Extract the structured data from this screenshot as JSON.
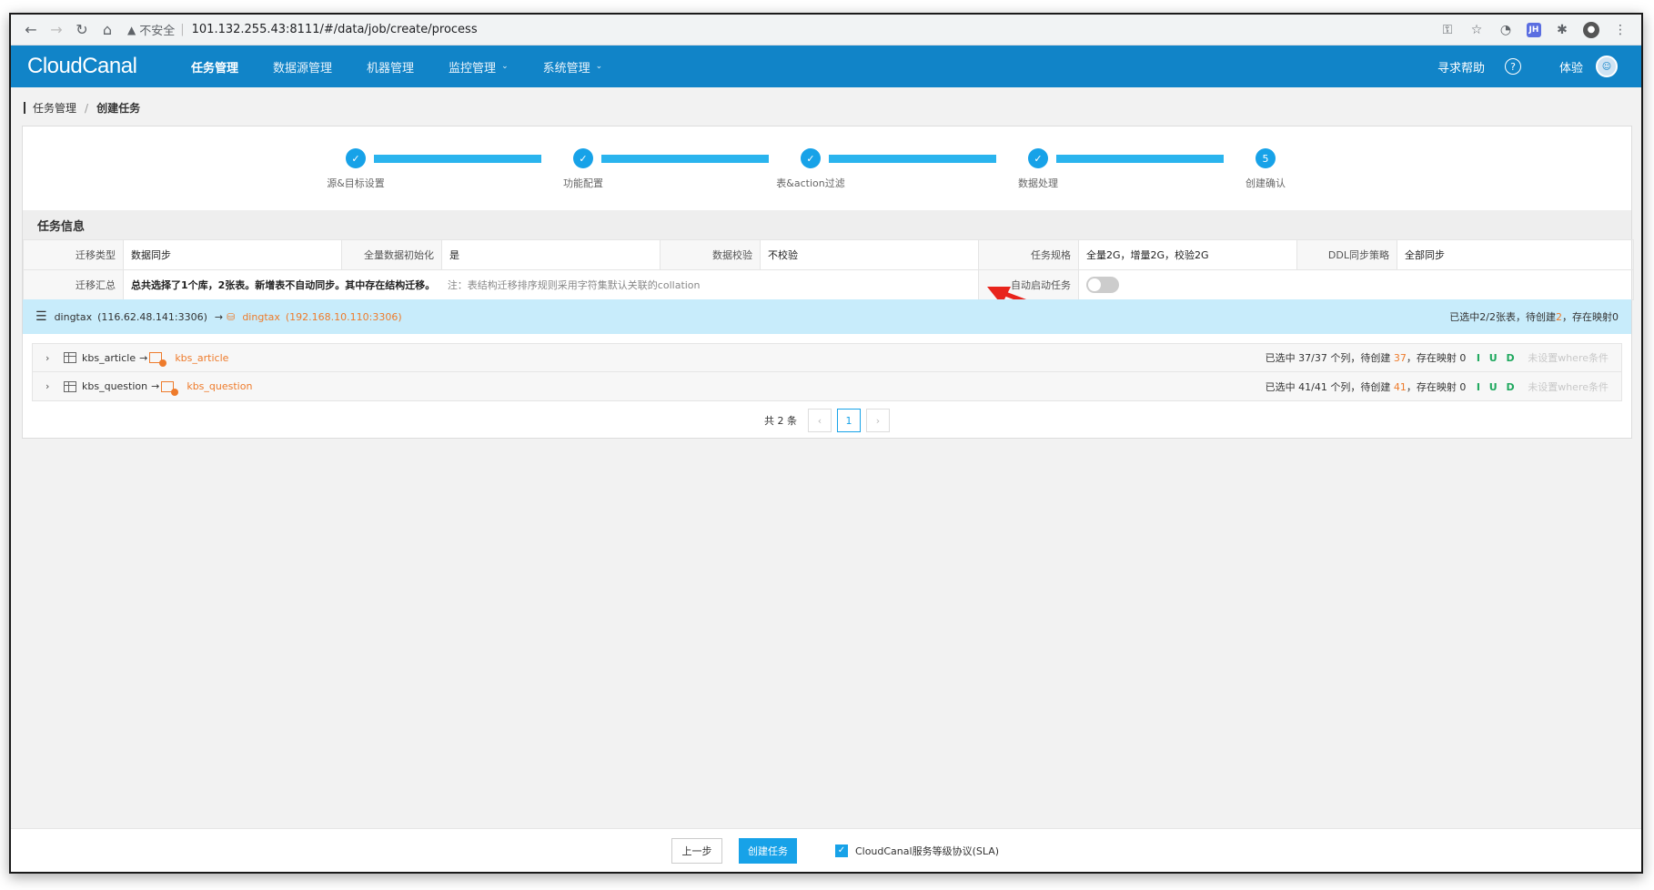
{
  "browser": {
    "insecure": "不安全",
    "url": "101.132.255.43:8111/#/data/job/create/process"
  },
  "header": {
    "logo": "CloudCanal",
    "menu": [
      {
        "label": "任务管理",
        "active": true,
        "has_caret": false
      },
      {
        "label": "数据源管理",
        "active": false,
        "has_caret": false
      },
      {
        "label": "机器管理",
        "active": false,
        "has_caret": false
      },
      {
        "label": "监控管理",
        "active": false,
        "has_caret": true
      },
      {
        "label": "系统管理",
        "active": false,
        "has_caret": true
      }
    ],
    "help": "寻求帮助",
    "user": "体验"
  },
  "breadcrumb": {
    "parent": "任务管理",
    "separator": "/",
    "current": "创建任务"
  },
  "steps": [
    {
      "label": "源&目标设置",
      "status": "done"
    },
    {
      "label": "功能配置",
      "status": "done"
    },
    {
      "label": "表&action过滤",
      "status": "done"
    },
    {
      "label": "数据处理",
      "status": "done"
    },
    {
      "label": "创建确认",
      "status": "current",
      "number": "5"
    }
  ],
  "task_info": {
    "title": "任务信息",
    "row1": [
      {
        "key": "迁移类型",
        "value": "数据同步"
      },
      {
        "key": "全量数据初始化",
        "value": "是"
      },
      {
        "key": "数据校验",
        "value": "不校验"
      },
      {
        "key": "任务规格",
        "value": "全量2G，增量2G，校验2G"
      },
      {
        "key": "DDL同步策略",
        "value": "全部同步"
      }
    ],
    "summary_key": "迁移汇总",
    "summary_value": "总共选择了1个库，2张表。新增表不自动同步。其中存在结构迁移。",
    "summary_note": "注：表结构迁移排序规则采用字符集默认关联的collation",
    "auto_start_key": "自动启动任务",
    "auto_start_enabled": false
  },
  "db_mapping": {
    "source_name": "dingtax",
    "source_addr": "(116.62.48.141:3306)",
    "target_name": "dingtax",
    "target_addr": "(192.168.10.110:3306)",
    "summary_prefix": "已选中2/2张表，待创建",
    "summary_create": "2",
    "summary_suffix": "，存在映射0"
  },
  "tables": [
    {
      "source": "kbs_article",
      "target": "kbs_article",
      "selected": "已选中 37/37 个列，待创建",
      "create": "37",
      "mapped": "，存在映射 0",
      "iud": "I U D",
      "where": "未设置where条件"
    },
    {
      "source": "kbs_question",
      "target": "kbs_question",
      "selected": "已选中 41/41 个列，待创建",
      "create": "41",
      "mapped": "，存在映射 0",
      "iud": "I U D",
      "where": "未设置where条件"
    }
  ],
  "pager": {
    "total": "共 2 条",
    "prev": "‹",
    "page": "1",
    "next": "›"
  },
  "footer": {
    "prev_label": "上一步",
    "create_label": "创建任务",
    "sla_label": "CloudCanal服务等级协议(SLA)",
    "sla_checked": true
  },
  "colors": {
    "brand": "#1184c8",
    "accent": "#17a2e8",
    "orange": "#ee7b2b",
    "iud_green": "#1fa85e",
    "arrow_red": "#e8241c"
  }
}
